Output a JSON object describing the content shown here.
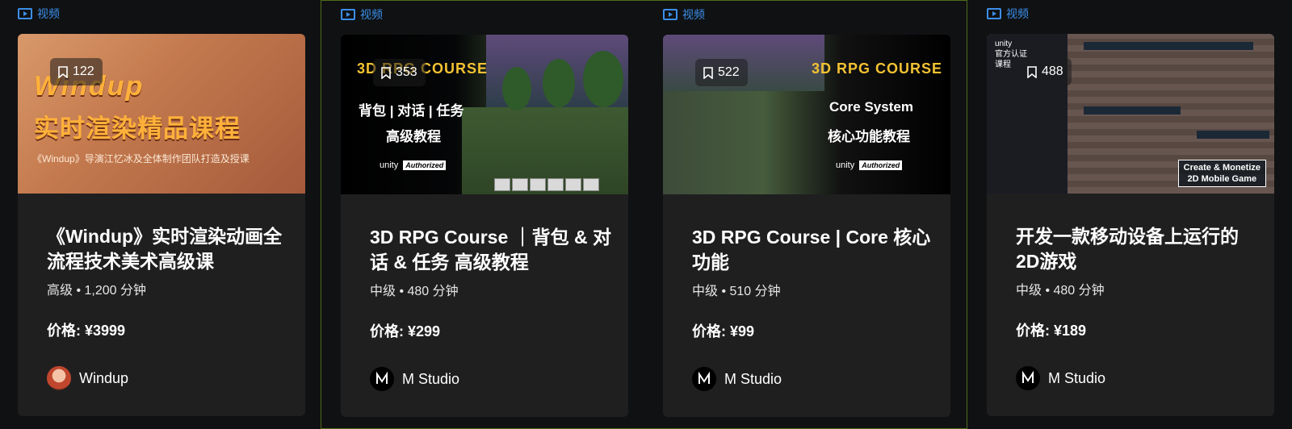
{
  "tag_label": "视频",
  "cards": [
    {
      "bookmarks": "122",
      "thumb": {
        "line1": "Windup",
        "line2": "实时渲染精品课程",
        "line3": "《Windup》导演江忆冰及全体制作团队打造及授课"
      },
      "title": "《Windup》实时渲染动画全流程技术美术高级课",
      "meta": "高级 • 1,200 分钟",
      "price": "价格: ¥3999",
      "author": "Windup"
    },
    {
      "bookmarks": "353",
      "thumb": {
        "game": "3D RPG COURSE",
        "zh1": "背包 | 对话 | 任务",
        "zh2": "高级教程",
        "unity": "unity",
        "authorized": "Authorized"
      },
      "title": "3D RPG Course ｜背包 & 对话 & 任务 高级教程",
      "meta": "中级 • 480 分钟",
      "price": "价格: ¥299",
      "author": "M Studio"
    },
    {
      "bookmarks": "522",
      "thumb": {
        "game": "3D RPG COURSE",
        "en": "Core System",
        "zh": "核心功能教程",
        "unity": "unity",
        "authorized": "Authorized"
      },
      "title": "3D RPG Course | Core 核心功能",
      "meta": "中级 • 510 分钟",
      "price": "价格: ¥99",
      "author": "M Studio"
    },
    {
      "bookmarks": "488",
      "thumb": {
        "official_unity": "unity",
        "official_1": "官方认证",
        "official_2": "课程",
        "cmg1": "Create & Monetize",
        "cmg2": "2D Mobile Game"
      },
      "title": "开发一款移动设备上运行的2D游戏",
      "meta": "中级 • 480 分钟",
      "price": "价格: ¥189",
      "author": "M Studio"
    }
  ],
  "colors": {
    "accent": "#3b8fea",
    "card_bg": "#1f1f20",
    "page_bg": "#101113",
    "selection_border": "#4f6b1c"
  }
}
